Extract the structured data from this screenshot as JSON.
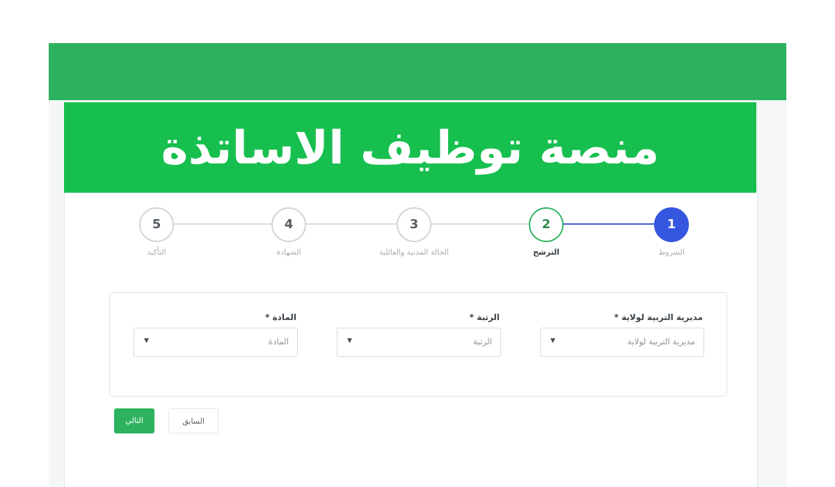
{
  "banner": {
    "title": "منصة توظيف الاساتذة"
  },
  "stepper": {
    "steps": [
      {
        "number": "1",
        "label": "الشروط",
        "state": "done"
      },
      {
        "number": "2",
        "label": "الترشح",
        "state": "current"
      },
      {
        "number": "3",
        "label": "الحالة المدنية والعائلية",
        "state": "pending"
      },
      {
        "number": "4",
        "label": "الشهادة",
        "state": "pending"
      },
      {
        "number": "5",
        "label": "التأكيد",
        "state": "pending"
      }
    ]
  },
  "form": {
    "fields": [
      {
        "label": "مديرية التربية لولاية *",
        "value": "مديرية التربية لولاية"
      },
      {
        "label": "الرتبة *",
        "value": "الرتبة"
      },
      {
        "label": "المادة *",
        "value": "المادة"
      }
    ]
  },
  "buttons": {
    "next_label": "التالي",
    "prev_label": "السابق"
  },
  "colors": {
    "brand_green": "#17bf4f",
    "header_green": "#2db35f",
    "step_blue": "#3557e0"
  },
  "icons": {
    "select_arrow": "caret-down-icon"
  }
}
